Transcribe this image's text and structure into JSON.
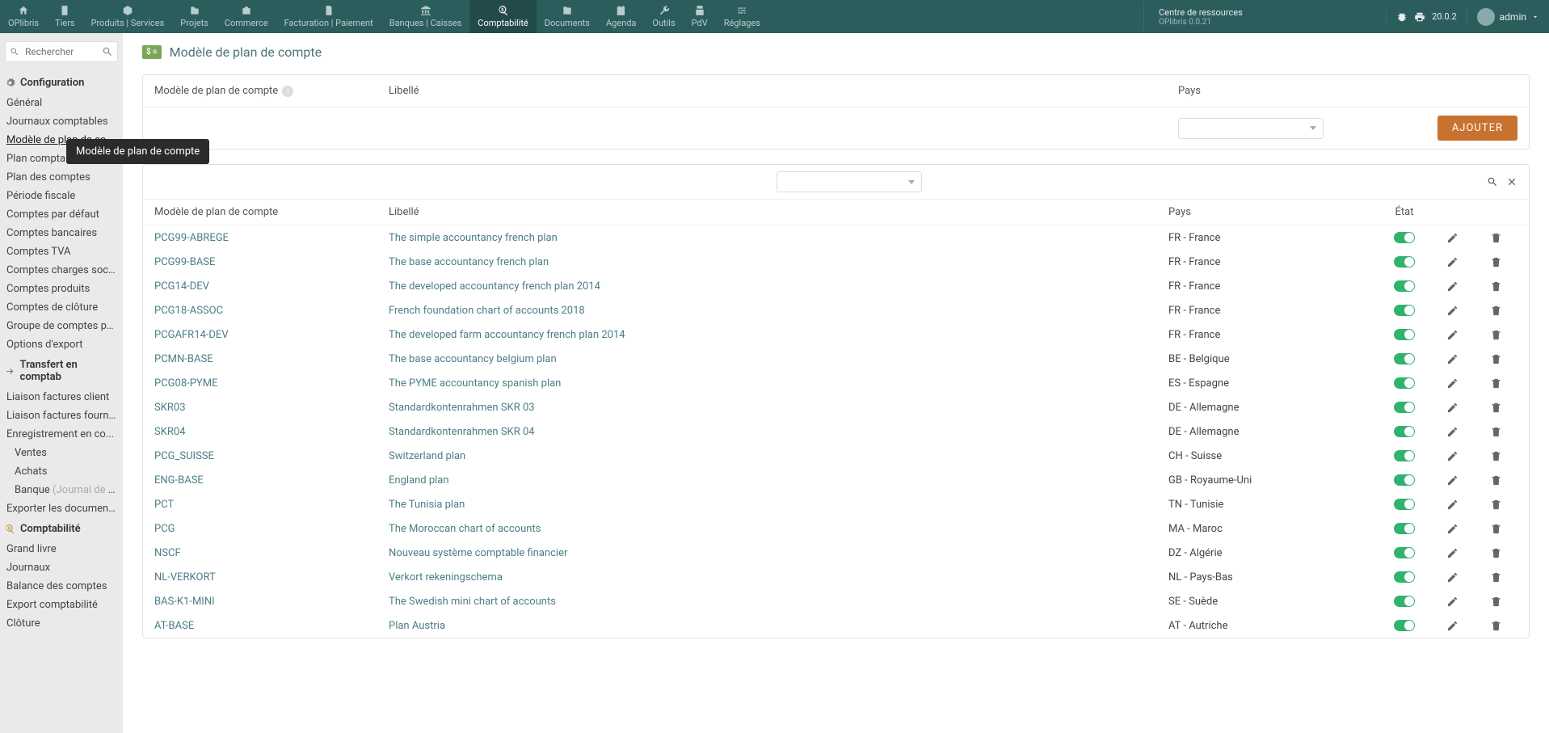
{
  "topnav": {
    "items": [
      {
        "label": "OPlibris",
        "icon": "home"
      },
      {
        "label": "Tiers",
        "icon": "building"
      },
      {
        "label": "Produits | Services",
        "icon": "cube"
      },
      {
        "label": "Projets",
        "icon": "project"
      },
      {
        "label": "Commerce",
        "icon": "briefcase"
      },
      {
        "label": "Facturation | Paiement",
        "icon": "invoice"
      },
      {
        "label": "Banques | Caisses",
        "icon": "bank"
      },
      {
        "label": "Comptabilité",
        "icon": "search-dollar"
      },
      {
        "label": "Documents",
        "icon": "folder"
      },
      {
        "label": "Agenda",
        "icon": "calendar"
      },
      {
        "label": "Outils",
        "icon": "wrench"
      },
      {
        "label": "PdV",
        "icon": "pos"
      },
      {
        "label": "Réglages",
        "icon": "sliders"
      }
    ],
    "active_index": 7,
    "resource": {
      "title": "Centre de ressources",
      "sub": "OPlibris 0.0.21"
    },
    "version": "20.0.2",
    "user": "admin"
  },
  "sidebar": {
    "search_placeholder": "Rechercher",
    "sections": [
      {
        "title": "Configuration",
        "icon": "gears",
        "items": [
          "Général",
          "Journaux comptables",
          "Modèle de plan de co...",
          "Plan comptable",
          "Plan des comptes",
          "Période fiscale",
          "Comptes par défaut",
          "Comptes bancaires",
          "Comptes TVA",
          "Comptes charges soc...",
          "Comptes produits",
          "Comptes de clôture",
          "Groupe de comptes pe...",
          "Options d'export"
        ],
        "active_index": 2
      },
      {
        "title": "Transfert en comptab",
        "icon": "arrow-right",
        "items": [
          "Liaison factures client",
          "Liaison factures fourni...",
          "Enregistrement en co..."
        ],
        "subitems": [
          "Ventes",
          "Achats"
        ],
        "banque": {
          "label": "Banque",
          "faded": "(Journal de t..."
        },
        "last": "Exporter les document..."
      },
      {
        "title": "Comptabilité",
        "icon": "search-dollar",
        "orange": true,
        "items": [
          "Grand livre",
          "Journaux",
          "Balance des comptes",
          "Export comptabilité",
          "Clôture"
        ]
      }
    ],
    "tooltip": "Modèle de plan de compte"
  },
  "page": {
    "title": "Modèle de plan de compte",
    "create_head": {
      "c1": "Modèle de plan de compte",
      "c2": "Libellé",
      "c3": "Pays"
    },
    "add_button": "AJOUTER",
    "list_head": {
      "c1": "Modèle de plan de compte",
      "c2": "Libellé",
      "c3": "Pays",
      "c4": "État"
    },
    "rows": [
      {
        "code": "PCG99-ABREGE",
        "label": "The simple accountancy french plan",
        "country": "FR - France"
      },
      {
        "code": "PCG99-BASE",
        "label": "The base accountancy french plan",
        "country": "FR - France"
      },
      {
        "code": "PCG14-DEV",
        "label": "The developed accountancy french plan 2014",
        "country": "FR - France"
      },
      {
        "code": "PCG18-ASSOC",
        "label": "French foundation chart of accounts 2018",
        "country": "FR - France"
      },
      {
        "code": "PCGAFR14-DEV",
        "label": "The developed farm accountancy french plan 2014",
        "country": "FR - France"
      },
      {
        "code": "PCMN-BASE",
        "label": "The base accountancy belgium plan",
        "country": "BE - Belgique"
      },
      {
        "code": "PCG08-PYME",
        "label": "The PYME accountancy spanish plan",
        "country": "ES - Espagne"
      },
      {
        "code": "SKR03",
        "label": "Standardkontenrahmen SKR 03",
        "country": "DE - Allemagne"
      },
      {
        "code": "SKR04",
        "label": "Standardkontenrahmen SKR 04",
        "country": "DE - Allemagne"
      },
      {
        "code": "PCG_SUISSE",
        "label": "Switzerland plan",
        "country": "CH - Suisse"
      },
      {
        "code": "ENG-BASE",
        "label": "England plan",
        "country": "GB - Royaume-Uni"
      },
      {
        "code": "PCT",
        "label": "The Tunisia plan",
        "country": "TN - Tunisie"
      },
      {
        "code": "PCG",
        "label": "The Moroccan chart of accounts",
        "country": "MA - Maroc"
      },
      {
        "code": "NSCF",
        "label": "Nouveau système comptable financier",
        "country": "DZ - Algérie"
      },
      {
        "code": "NL-VERKORT",
        "label": "Verkort rekeningschema",
        "country": "NL - Pays-Bas"
      },
      {
        "code": "BAS-K1-MINI",
        "label": "The Swedish mini chart of accounts",
        "country": "SE - Suède"
      },
      {
        "code": "AT-BASE",
        "label": "Plan Austria",
        "country": "AT - Autriche"
      }
    ]
  }
}
